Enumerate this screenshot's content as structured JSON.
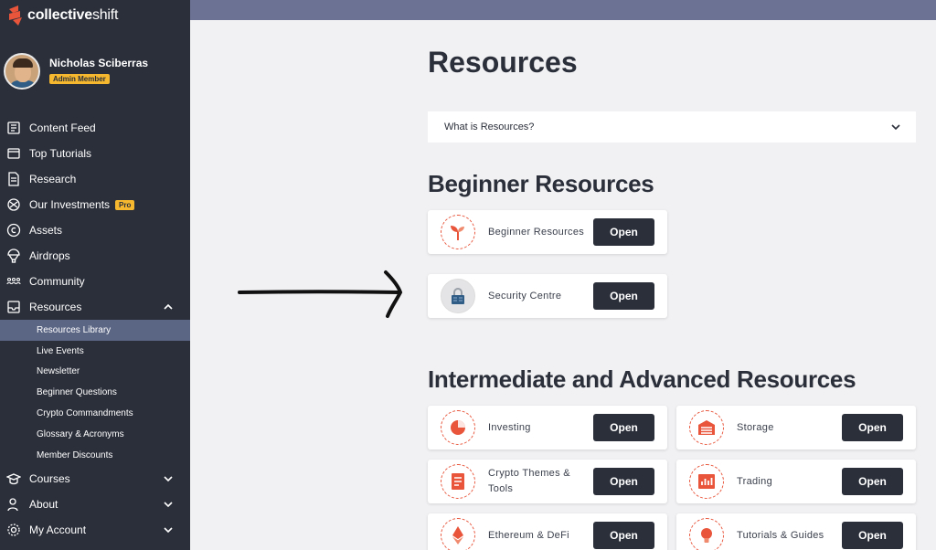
{
  "brand": {
    "bold": "collective",
    "light": "shift"
  },
  "profile": {
    "name": "Nicholas Sciberras",
    "role": "Admin Member"
  },
  "nav": {
    "content_feed": "Content Feed",
    "top_tutorials": "Top Tutorials",
    "research": "Research",
    "our_investments": "Our Investments",
    "pro_badge": "Pro",
    "assets": "Assets",
    "airdrops": "Airdrops",
    "community": "Community",
    "resources": "Resources",
    "sub": [
      "Resources Library",
      "Live Events",
      "Newsletter",
      "Beginner Questions",
      "Crypto Commandments",
      "Glossary & Acronyms",
      "Member Discounts"
    ],
    "courses": "Courses",
    "about": "About",
    "my_account": "My Account"
  },
  "page": {
    "title": "Resources",
    "accordion": "What is Resources?",
    "beginner_heading": "Beginner Resources",
    "advanced_heading": "Intermediate and Advanced Resources",
    "open_label": "Open",
    "beginner": [
      "Beginner Resources",
      "Security Centre"
    ],
    "advanced": [
      "Investing",
      "Storage",
      "Crypto Themes & Tools",
      "Trading",
      "Ethereum & DeFi",
      "Tutorials & Guides"
    ]
  },
  "colors": {
    "sidebar": "#2b2f3a",
    "accent": "#f5b82e",
    "brand_orange": "#e8553b",
    "active_sub": "#5b6685",
    "topbar": "#6b7294"
  }
}
